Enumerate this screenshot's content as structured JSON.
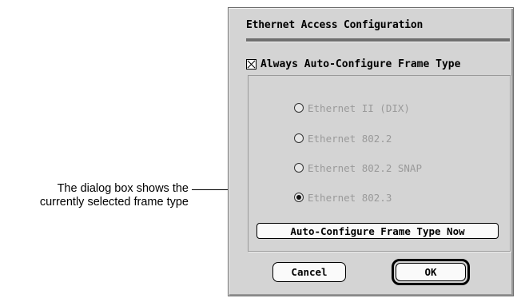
{
  "callout": {
    "line1": "The dialog box shows the",
    "line2": "currently selected frame type"
  },
  "dialog": {
    "title": "Ethernet Access Configuration",
    "auto_configure": {
      "label": "Always Auto-Configure Frame Type",
      "checked": true
    },
    "frame_types": [
      {
        "label": "Ethernet II (DIX)",
        "selected": false
      },
      {
        "label": "Ethernet 802.2",
        "selected": false
      },
      {
        "label": "Ethernet 802.2 SNAP",
        "selected": false
      },
      {
        "label": "Ethernet 802.3",
        "selected": true
      }
    ],
    "auto_configure_now_label": "Auto-Configure Frame Type Now",
    "cancel_label": "Cancel",
    "ok_label": "OK"
  }
}
